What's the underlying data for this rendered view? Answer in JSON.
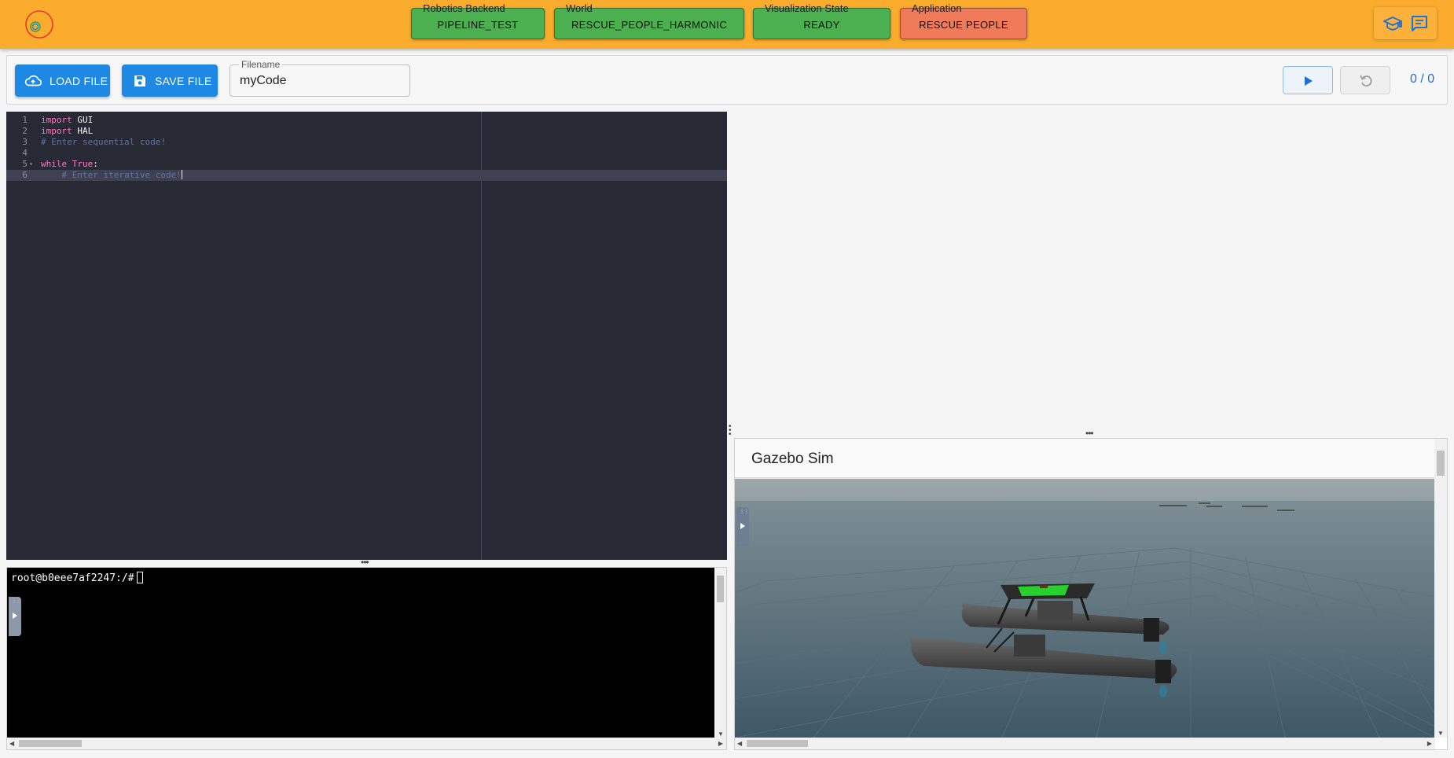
{
  "header": {
    "status": [
      {
        "label": "Robotics Backend",
        "value": "PIPELINE_TEST",
        "state": "ok"
      },
      {
        "label": "World",
        "value": "RESCUE_PEOPLE_HARMONIC",
        "state": "ok"
      },
      {
        "label": "Visualization State",
        "value": "READY",
        "state": "ok"
      },
      {
        "label": "Application",
        "value": "RESCUE PEOPLE",
        "state": "error"
      }
    ],
    "icons": [
      "graduation-cap-icon",
      "chat-icon"
    ],
    "colors": {
      "bar": "#fbac2d",
      "ok": "#4caf50",
      "error": "#ef7b5a"
    }
  },
  "toolbar": {
    "load_label": "LOAD FILE",
    "save_label": "SAVE FILE",
    "filename_label": "Filename",
    "filename_value": "myCode",
    "counter": "0 / 0",
    "accent": "#1e88e5"
  },
  "editor": {
    "lines": [
      {
        "num": "1",
        "tokens": [
          {
            "t": "import",
            "c": "kw"
          },
          {
            "t": " GUI",
            "c": "id"
          }
        ]
      },
      {
        "num": "2",
        "tokens": [
          {
            "t": "import",
            "c": "kw"
          },
          {
            "t": " HAL",
            "c": "id"
          }
        ]
      },
      {
        "num": "3",
        "tokens": [
          {
            "t": "# Enter sequential code!",
            "c": "cm"
          }
        ]
      },
      {
        "num": "4",
        "tokens": []
      },
      {
        "num": "5",
        "tokens": [
          {
            "t": "while",
            "c": "kw"
          },
          {
            "t": " True",
            "c": "kw"
          },
          {
            "t": ":",
            "c": "id"
          }
        ]
      },
      {
        "num": "6",
        "tokens": [
          {
            "t": "    # Enter iterative code!",
            "c": "cm"
          }
        ]
      }
    ],
    "active_line": 6,
    "zoom_in": "+",
    "zoom_out": "−"
  },
  "terminal": {
    "prompt": "root@b0eee7af2247:/#"
  },
  "gazebo": {
    "title": "Gazebo Sim"
  }
}
